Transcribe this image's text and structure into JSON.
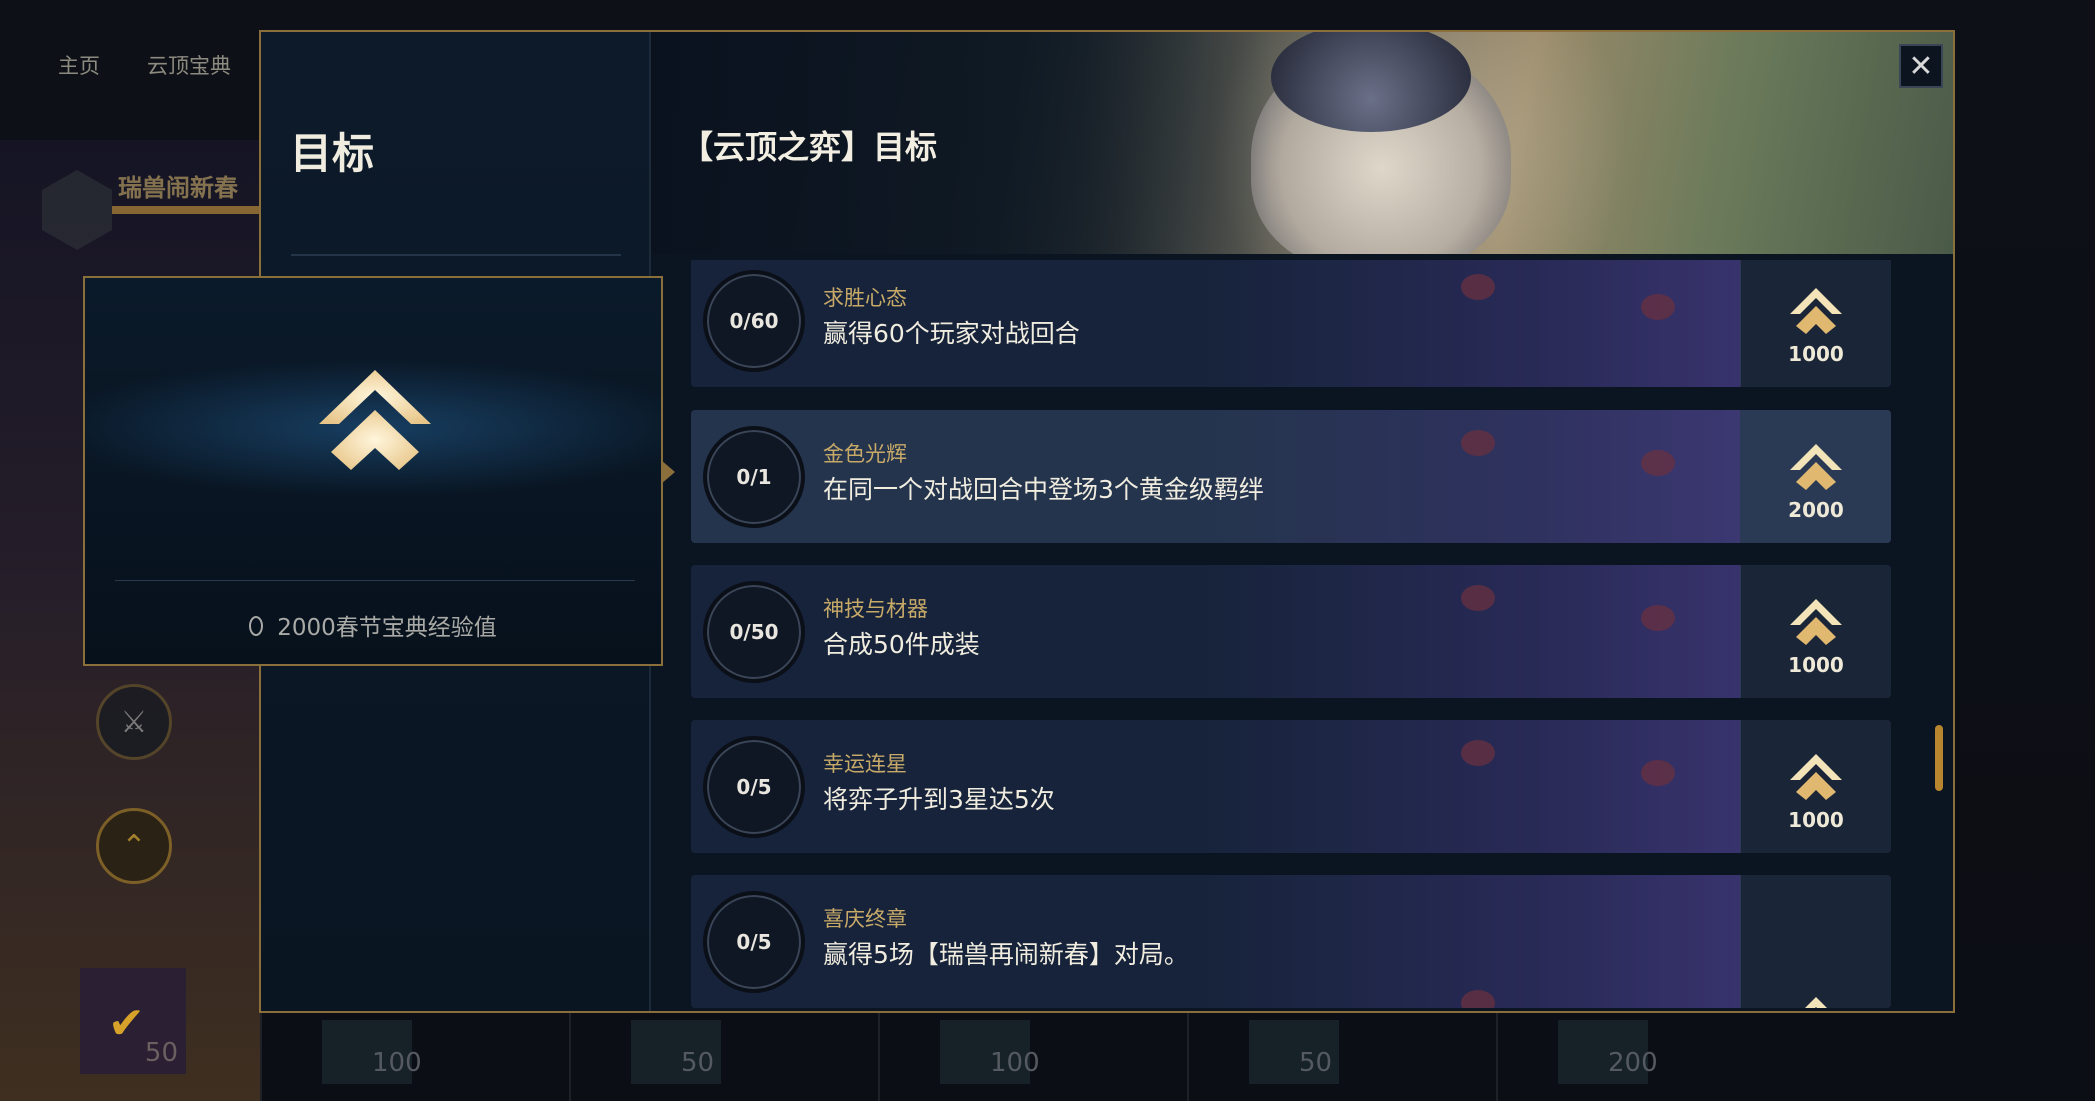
{
  "background": {
    "nav": [
      "主页",
      "云顶宝典"
    ],
    "pass_title": "瑞兽闹新春",
    "left_reward_value": "50",
    "reward_values": [
      "100",
      "50",
      "100",
      "50",
      "200"
    ]
  },
  "modal": {
    "left_title": "目标",
    "banner_title": "【云顶之弈】目标",
    "close_label": "✕"
  },
  "tooltip": {
    "label": "2000春节宝典经验值"
  },
  "objectives": [
    {
      "progress": "0/60",
      "name": "求胜心态",
      "description": "赢得60个玩家对战回合",
      "reward": "1000",
      "selected": false
    },
    {
      "progress": "0/1",
      "name": "金色光辉",
      "description": "在同一个对战回合中登场3个黄金级羁绊",
      "reward": "2000",
      "selected": true
    },
    {
      "progress": "0/50",
      "name": "神技与材器",
      "description": "合成50件成装",
      "reward": "1000",
      "selected": false
    },
    {
      "progress": "0/5",
      "name": "幸运连星",
      "description": "将弈子升到3星达5次",
      "reward": "1000",
      "selected": false
    },
    {
      "progress": "0/5",
      "name": "喜庆终章",
      "description": "赢得5场【瑞兽再闹新春】对局。",
      "reward": "",
      "selected": false
    }
  ],
  "colors": {
    "accent_gold": "#c7a968",
    "frame_gold": "#8b6f3a",
    "panel_dark": "#0b1421"
  },
  "icons": {
    "reward": "chevron-up-icon",
    "close": "close-icon",
    "exp_drop": "drop-icon"
  }
}
